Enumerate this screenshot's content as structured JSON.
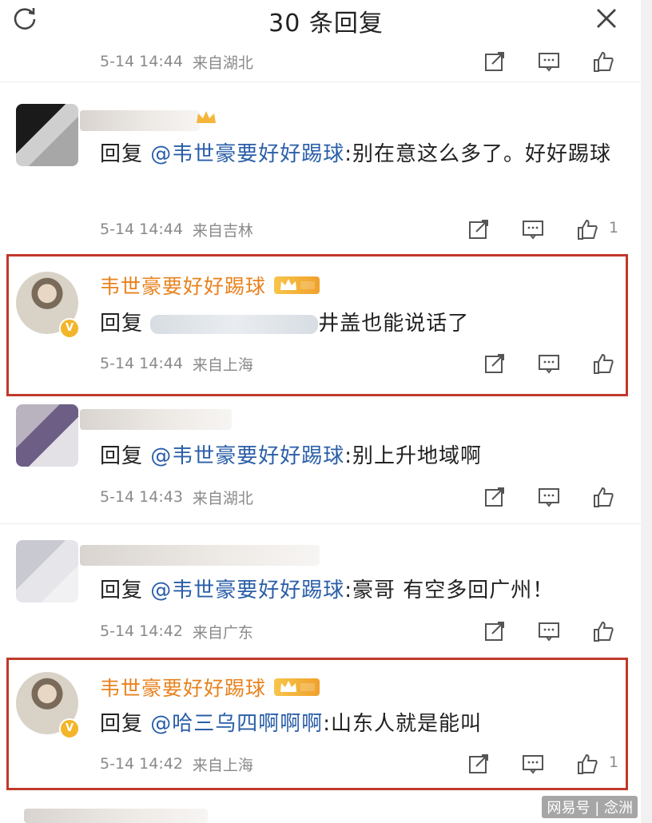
{
  "header": {
    "title": "30 条回复"
  },
  "colors": {
    "username": "#e8821e",
    "mention": "#2a5ea8",
    "meta": "#8a8a8a",
    "highlight": "#c0392b"
  },
  "comments": [
    {
      "date": "5-14 14:44",
      "from": "来自湖北",
      "like_count": ""
    },
    {
      "prefix": "回复 ",
      "mention": "@韦世豪要好好踢球",
      "body": ":别在意这么多了。好好踢球",
      "date": "5-14 14:44",
      "from": "来自吉林",
      "like_count": "1"
    },
    {
      "username": "韦世豪要好好踢球",
      "prefix": "回复 ",
      "body": "井盖也能说话了",
      "date": "5-14 14:44",
      "from": "来自上海",
      "like_count": ""
    },
    {
      "prefix": "回复 ",
      "mention": "@韦世豪要好好踢球",
      "body": ":别上升地域啊",
      "date": "5-14 14:43",
      "from": "来自湖北",
      "like_count": ""
    },
    {
      "prefix": "回复 ",
      "mention": "@韦世豪要好好踢球",
      "body": ":豪哥 有空多回广州！",
      "date": "5-14 14:42",
      "from": "来自广东",
      "like_count": ""
    },
    {
      "username": "韦世豪要好好踢球",
      "prefix": "回复 ",
      "mention": "@哈三乌四啊啊啊",
      "body": ":山东人就是能叫",
      "date": "5-14 14:42",
      "from": "来自上海",
      "like_count": "1"
    }
  ],
  "watermark": "网易号 | 念洲"
}
